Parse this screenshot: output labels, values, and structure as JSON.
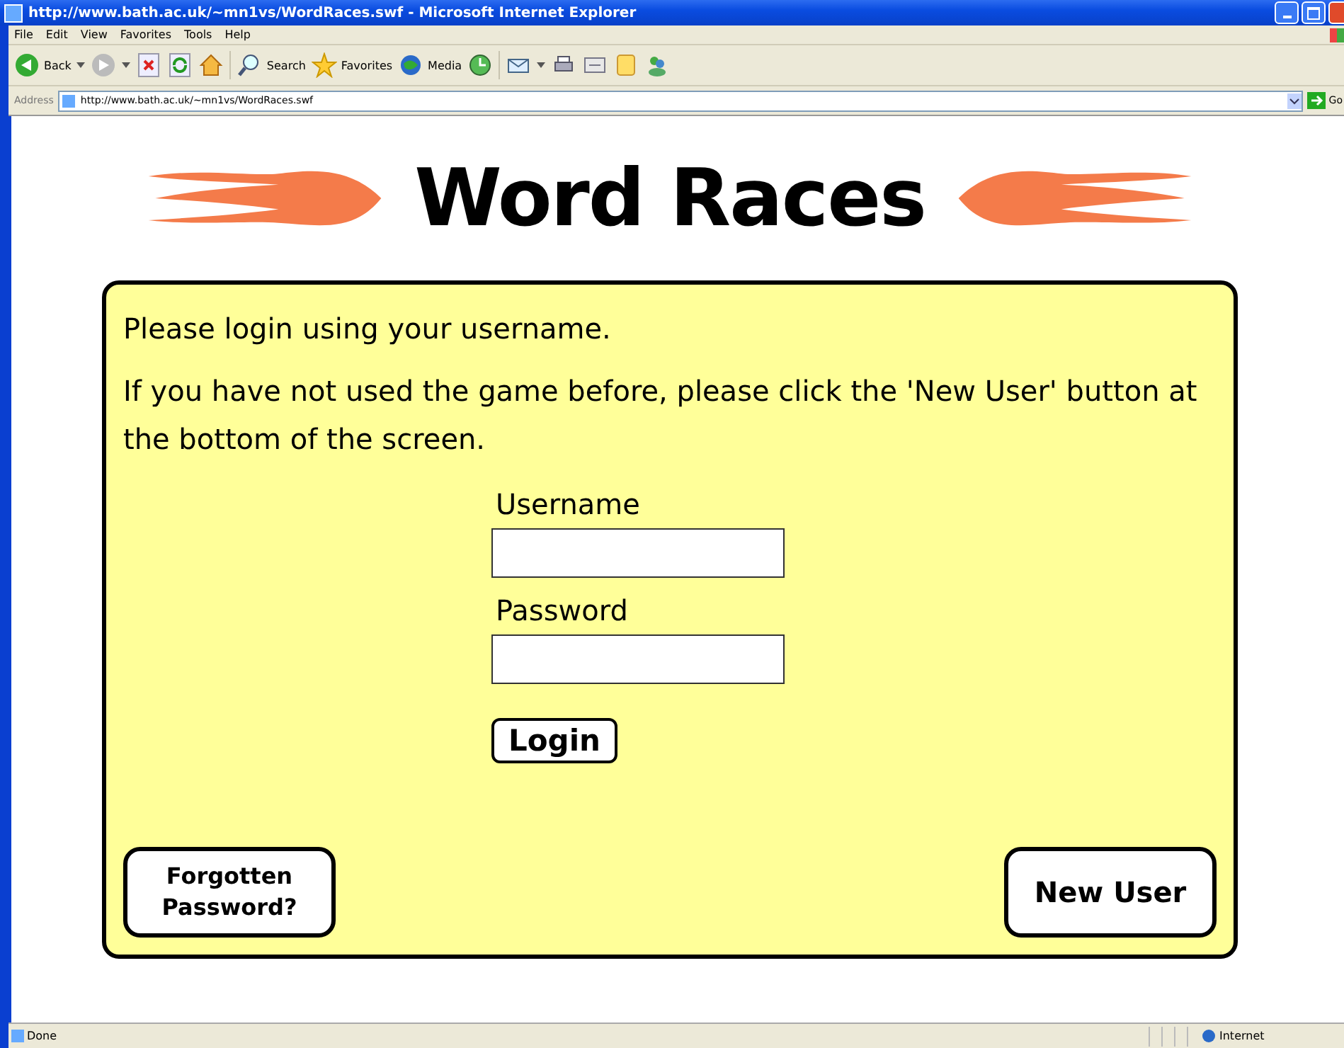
{
  "window": {
    "title": "http://www.bath.ac.uk/~mn1vs/WordRaces.swf - Microsoft Internet Explorer"
  },
  "menu": [
    "File",
    "Edit",
    "View",
    "Favorites",
    "Tools",
    "Help"
  ],
  "toolbar": {
    "back": "Back",
    "search": "Search",
    "favorites": "Favorites",
    "media": "Media"
  },
  "address": {
    "label": "Address",
    "value": "http://www.bath.ac.uk/~mn1vs/WordRaces.swf",
    "go": "Go"
  },
  "game": {
    "title": "Word Races",
    "intro": "Please login using your username.",
    "help": "If you have not used the game before, please click the 'New User' button at the bottom of the screen.",
    "username_label": "Username",
    "password_label": "Password",
    "login": "Login",
    "forgotten": "Forgotten Password?",
    "new_user": "New User"
  },
  "status_bar": {
    "text": "Done",
    "zone": "Internet"
  }
}
